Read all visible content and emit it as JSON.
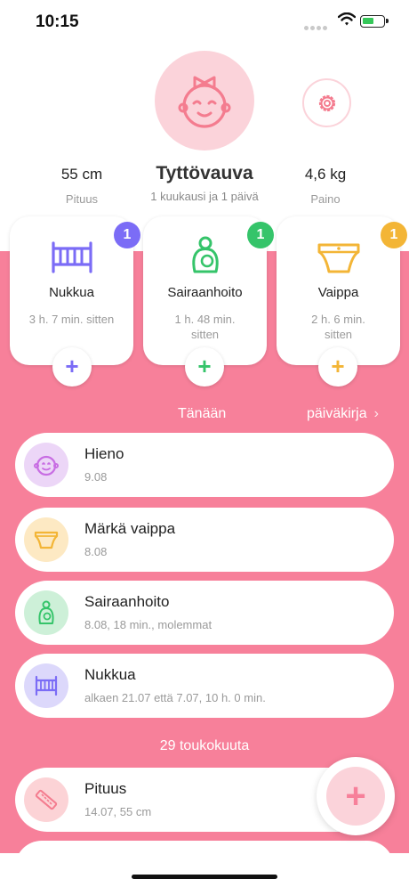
{
  "status_bar": {
    "time": "10:15"
  },
  "profile": {
    "name": "Tyttövauva",
    "age": "1 kuukausi ja 1 päivä",
    "height_value": "55 cm",
    "height_label": "Pituus",
    "weight_value": "4,6 kg",
    "weight_label": "Paino"
  },
  "cards": [
    {
      "title": "Nukkua",
      "ago": "3 h. 7 min. sitten",
      "badge": "1",
      "color": "#7b6cf6",
      "icon": "crib-icon"
    },
    {
      "title": "Sairaanhoito",
      "ago": "1 h. 48 min. sitten",
      "badge": "1",
      "color": "#35c46a",
      "icon": "breastfeeding-icon"
    },
    {
      "title": "Vaippa",
      "ago": "2 h. 6 min. sitten",
      "badge": "1",
      "color": "#f3b536",
      "icon": "diaper-icon"
    }
  ],
  "today": {
    "label": "Tänään",
    "diary_link": "päiväkirja"
  },
  "entries": [
    {
      "title": "Hieno",
      "subtitle": "9.08",
      "icon": "baby-face-icon",
      "icon_bg": "#ecd6f7"
    },
    {
      "title": "Märkä vaippa",
      "subtitle": "8.08",
      "icon": "diaper-icon",
      "icon_bg": "#fde9c3"
    },
    {
      "title": "Sairaanhoito",
      "subtitle": "8.08, 18 min., molemmat",
      "icon": "breastfeeding-icon",
      "icon_bg": "#cdf0d8"
    },
    {
      "title": "Nukkua",
      "subtitle": "alkaen 21.07 että 7.07, 10 h. 0 min.",
      "icon": "crib-icon",
      "icon_bg": "#dcd8fb"
    }
  ],
  "section_date": "29 toukokuuta",
  "older_entries": [
    {
      "title": "Pituus",
      "subtitle": "14.07, 55 cm",
      "icon": "ruler-icon",
      "icon_bg": "#fcd3d6"
    }
  ],
  "colors": {
    "accent": "#f7809a",
    "accent_light": "#fbd3da"
  }
}
